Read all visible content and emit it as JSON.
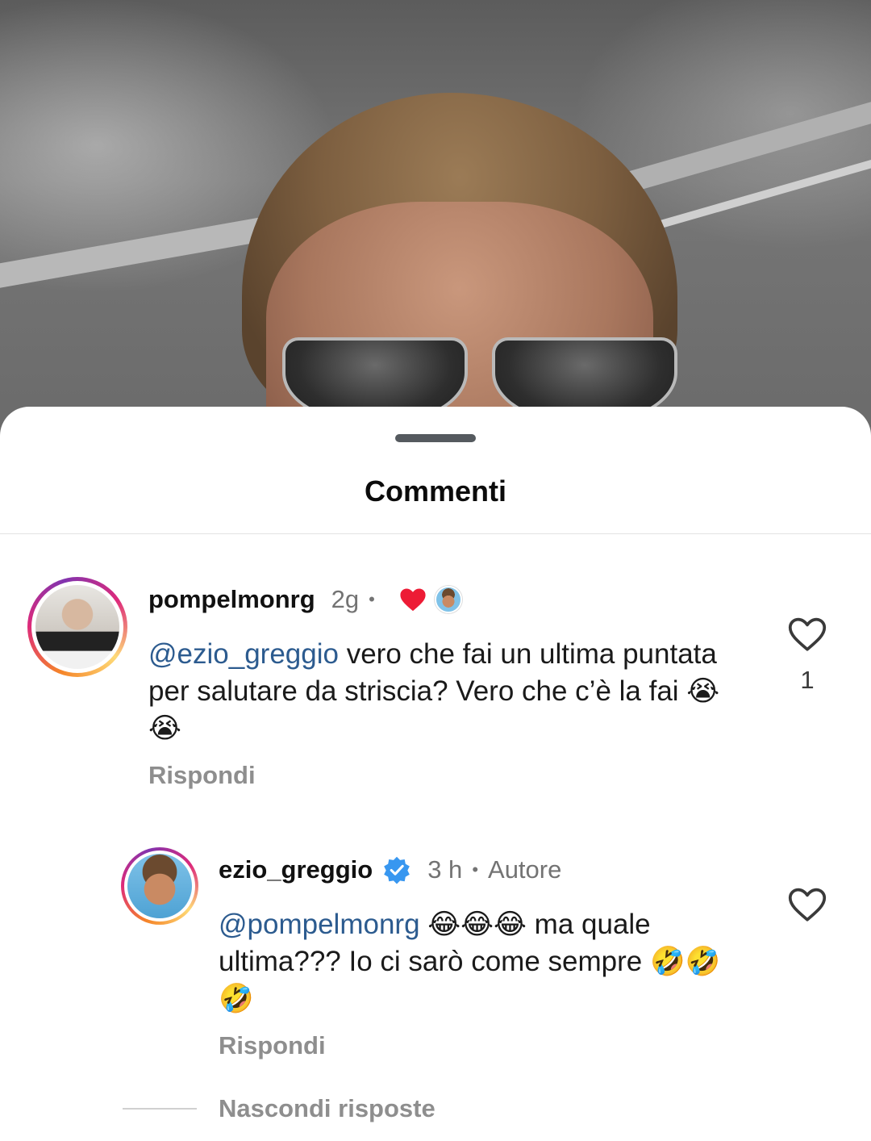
{
  "sheet": {
    "title": "Commenti"
  },
  "comments": [
    {
      "username": "pompelmonrg",
      "time": "2g",
      "separator": "•",
      "liked_by_author": true,
      "mention": "@ezio_greggio",
      "body": " vero che fai un ultima puntata per salutare da striscia? Vero che c’è la fai 😭😭",
      "reply_label": "Rispondi",
      "like_count": "1",
      "icons": [
        "avatar",
        "heart-filled-icon",
        "author-avatar-mini",
        "heart-outline-icon"
      ]
    },
    {
      "username": "ezio_greggio",
      "verified": true,
      "time": "3 h",
      "separator": "•",
      "author_badge": "Autore",
      "mention": "@pompelmonrg",
      "body": " 😂😂😂 ma quale ultima??? Io ci sarò come sempre 🤣🤣🤣",
      "reply_label": "Rispondi",
      "icons": [
        "avatar",
        "verified-badge-icon",
        "heart-outline-icon"
      ]
    }
  ],
  "thread": {
    "hide_replies_label": "Nascondi risposte"
  },
  "colors": {
    "mention": "#2c5b8f",
    "secondary_text": "#737373",
    "like_red": "#ed1b35",
    "verified_blue": "#3897f0"
  }
}
